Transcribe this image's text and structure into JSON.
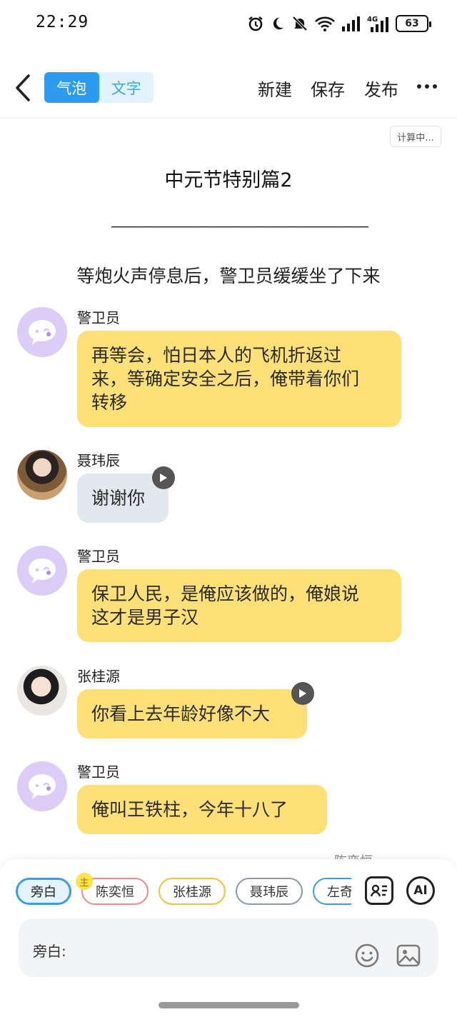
{
  "status_bar": {
    "time": "22:29",
    "network": "4G",
    "battery": "63",
    "icons": [
      "alarm-icon",
      "moon-icon",
      "mute-bell-icon",
      "wifi-icon",
      "signal-icon",
      "signal-4g-icon",
      "battery-icon"
    ]
  },
  "header": {
    "tabs": [
      {
        "label": "气泡",
        "active": true
      },
      {
        "label": "文字",
        "active": false
      }
    ],
    "actions": {
      "new": "新建",
      "save": "保存",
      "publish": "发布"
    }
  },
  "calc_badge": "计算中...",
  "story": {
    "title": "中元节特别篇2",
    "divider": "——————————————————",
    "narration": "等炮火声停息后，警卫员缓缓坐了下来"
  },
  "messages": [
    {
      "speaker": "警卫员",
      "line1": "再等会，怕日本人的飞机折返过",
      "line2": "来，等确定安全之后，俺带着你们",
      "line3": "转移",
      "avatar": "bot-avatar",
      "color": "#fee079"
    },
    {
      "speaker": "聂玮辰",
      "line1": "谢谢你",
      "avatar": "photo-avatar",
      "color": "#e3e8ee",
      "has_audio": true
    },
    {
      "speaker": "警卫员",
      "line1": "保卫人民，是俺应该做的，俺娘说",
      "line2": "这才是男子汉",
      "avatar": "bot-avatar",
      "color": "#fee079"
    },
    {
      "speaker": "张桂源",
      "line1": "你看上去年龄好像不大",
      "avatar": "photo-avatar",
      "color": "#fee079",
      "has_audio": true
    },
    {
      "speaker": "警卫员",
      "line1": "俺叫王铁柱，今年十八了",
      "avatar": "bot-avatar",
      "color": "#fee079"
    }
  ],
  "peek_text": "陈奕恒",
  "role_chips": [
    {
      "label": "旁白",
      "selected": true
    },
    {
      "label": "陈奕恒",
      "badge": "主"
    },
    {
      "label": "张桂源"
    },
    {
      "label": "聂玮辰"
    },
    {
      "label": "左奇函"
    }
  ],
  "tools": {
    "ai_label": "AI"
  },
  "input": {
    "label": "旁白:"
  }
}
